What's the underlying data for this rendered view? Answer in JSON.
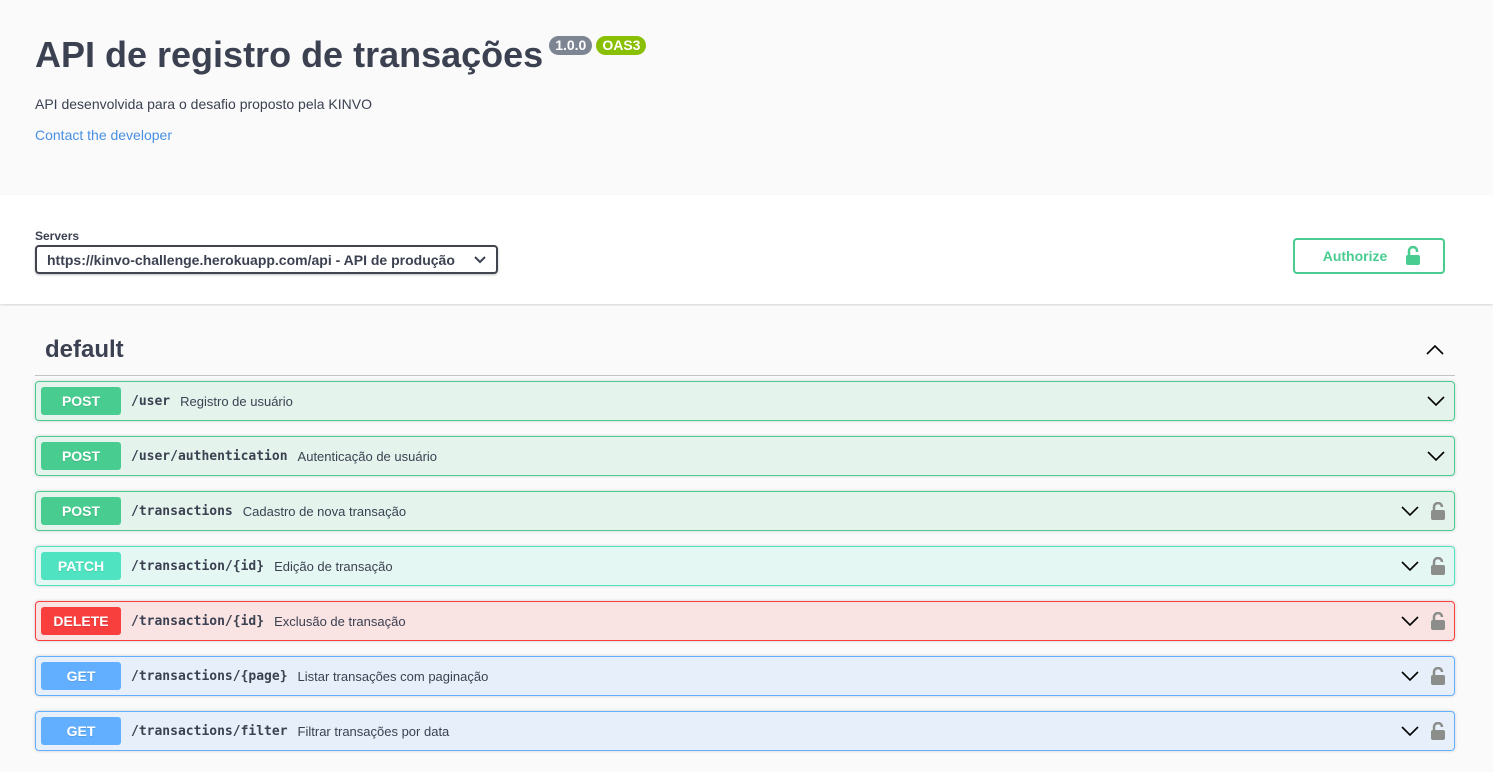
{
  "info": {
    "title": "API de registro de transações",
    "version": "1.0.0",
    "oas": "OAS3",
    "description": "API desenvolvida para o desafio proposto pela KINVO",
    "contact": "Contact the developer"
  },
  "servers": {
    "label": "Servers",
    "selected": "https://kinvo-challenge.herokuapp.com/api - API de produção"
  },
  "authorize": {
    "label": "Authorize",
    "icon": "unlock-icon"
  },
  "tag": {
    "name": "default"
  },
  "colors": {
    "POST": "#49cc90",
    "PATCH": "#50e3c2",
    "DELETE": "#f93e3e",
    "GET": "#61affe"
  },
  "operations": [
    {
      "method": "POST",
      "path": "/user",
      "summary": "Registro de usuário",
      "locked": false
    },
    {
      "method": "POST",
      "path": "/user/authentication",
      "summary": "Autenticação de usuário",
      "locked": false
    },
    {
      "method": "POST",
      "path": "/transactions",
      "summary": "Cadastro de nova transação",
      "locked": true
    },
    {
      "method": "PATCH",
      "path": "/transaction/{id}",
      "summary": "Edição de transação",
      "locked": true
    },
    {
      "method": "DELETE",
      "path": "/transaction/{id}",
      "summary": "Exclusão de transação",
      "locked": true
    },
    {
      "method": "GET",
      "path": "/transactions/{page}",
      "summary": "Listar transações com paginação",
      "locked": true
    },
    {
      "method": "GET",
      "path": "/transactions/filter",
      "summary": "Filtrar transações por data",
      "locked": true
    }
  ]
}
